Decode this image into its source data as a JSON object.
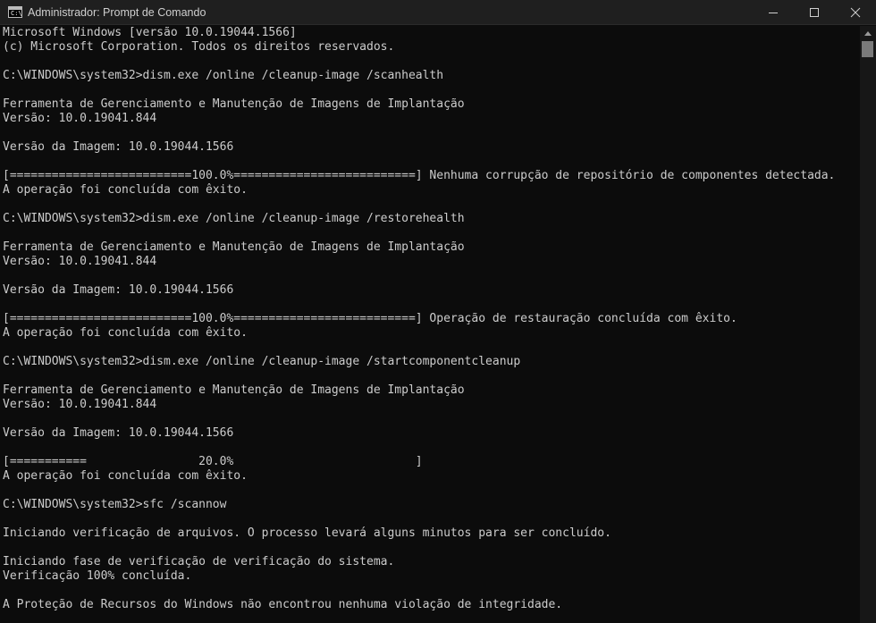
{
  "window": {
    "title": "Administrador: Prompt de Comando",
    "icon": "cmd-icon",
    "icon_glyph": "C:\\",
    "controls": {
      "minimize_icon": "minimize-icon",
      "maximize_icon": "maximize-icon",
      "close_icon": "close-icon"
    }
  },
  "colors": {
    "background": "#0c0c0c",
    "text": "#cccccc",
    "titlebar": "#1f1f1f"
  },
  "console": {
    "lines": [
      "Microsoft Windows [versão 10.0.19044.1566]",
      "(c) Microsoft Corporation. Todos os direitos reservados.",
      "",
      "C:\\WINDOWS\\system32>dism.exe /online /cleanup-image /scanhealth",
      "",
      "Ferramenta de Gerenciamento e Manutenção de Imagens de Implantação",
      "Versão: 10.0.19041.844",
      "",
      "Versão da Imagem: 10.0.19044.1566",
      "",
      "[==========================100.0%==========================] Nenhuma corrupção de repositório de componentes detectada.",
      "A operação foi concluída com êxito.",
      "",
      "C:\\WINDOWS\\system32>dism.exe /online /cleanup-image /restorehealth",
      "",
      "Ferramenta de Gerenciamento e Manutenção de Imagens de Implantação",
      "Versão: 10.0.19041.844",
      "",
      "Versão da Imagem: 10.0.19044.1566",
      "",
      "[==========================100.0%==========================] Operação de restauração concluída com êxito.",
      "A operação foi concluída com êxito.",
      "",
      "C:\\WINDOWS\\system32>dism.exe /online /cleanup-image /startcomponentcleanup",
      "",
      "Ferramenta de Gerenciamento e Manutenção de Imagens de Implantação",
      "Versão: 10.0.19041.844",
      "",
      "Versão da Imagem: 10.0.19044.1566",
      "",
      "[===========                20.0%                          ]",
      "A operação foi concluída com êxito.",
      "",
      "C:\\WINDOWS\\system32>sfc /scannow",
      "",
      "Iniciando verificação de arquivos. O processo levará alguns minutos para ser concluído.",
      "",
      "Iniciando fase de verificação de verificação do sistema.",
      "Verificação 100% concluída.",
      "",
      "A Proteção de Recursos do Windows não encontrou nenhuma violação de integridade."
    ]
  }
}
